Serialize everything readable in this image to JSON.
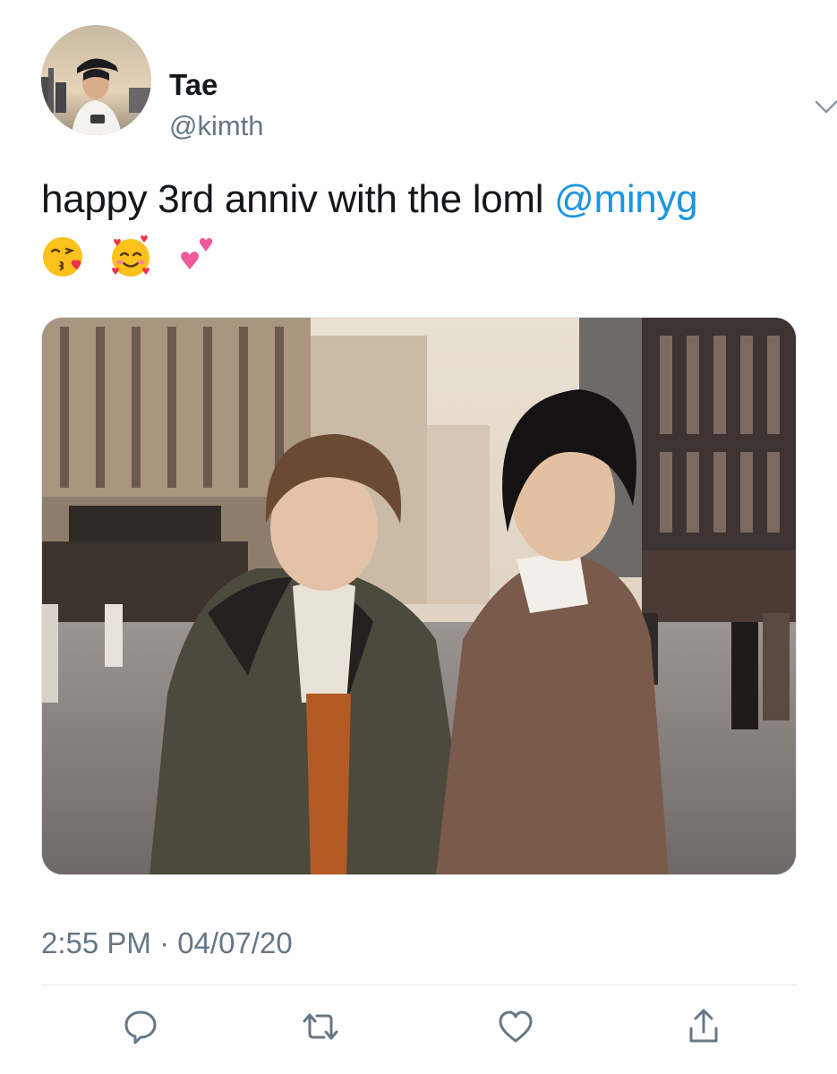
{
  "tweet": {
    "author": {
      "display_name": "Tae",
      "handle": "@kimth"
    },
    "text": "happy 3rd anniv with the loml ",
    "mention": "@minyg",
    "emojis": [
      "kissing-face-with-heart-emoji",
      "smiling-face-with-hearts-emoji",
      "two-hearts-emoji"
    ],
    "timestamp": "2:55 PM · 04/07/20",
    "media": {
      "type": "photo",
      "description": "two-people-street-photo"
    },
    "actions": [
      "reply-icon",
      "retweet-icon",
      "like-icon",
      "share-icon"
    ]
  },
  "colors": {
    "text": "#14171a",
    "secondary": "#657786",
    "link": "#1b95e0",
    "divider": "#e1e8ed"
  }
}
